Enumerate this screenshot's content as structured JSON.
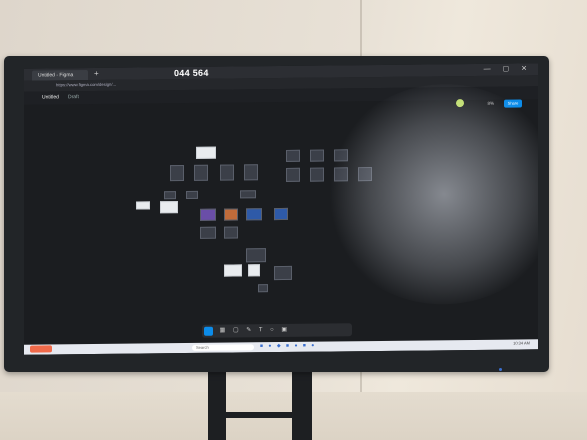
{
  "scene": {
    "description_free": true
  },
  "browser": {
    "tab_title": "Untitled - Figma",
    "new_tab_glyph": "+",
    "url": "https://www.figma.com/design/...",
    "window_controls": "— ▢ ✕"
  },
  "overlay": {
    "meeting_code": "044 564"
  },
  "figma": {
    "file_name": "Untitled",
    "drafts_label": "Draft",
    "zoom": "8%",
    "share_label": "Share",
    "toolbar_glyphs": "▲ ▦ ▢ ✎ T ○ ▣"
  },
  "taskbar": {
    "search_placeholder": "Search",
    "apps_glyphs": "■ ● ◆ ■ ● ■ ●",
    "clock": "10:34 AM"
  },
  "colors": {
    "figma_blue": "#0c8ce9",
    "canvas_bg": "#1b1d20",
    "wall": "#e8e1d6"
  }
}
